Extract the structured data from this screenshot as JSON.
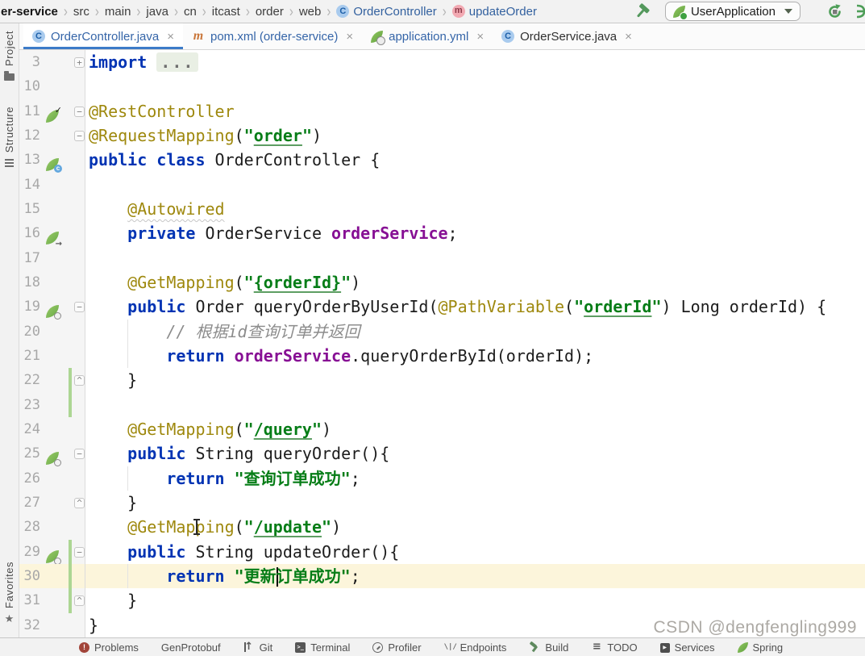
{
  "breadcrumb_bar": {
    "separator": "›",
    "path": [
      {
        "label": "er-service",
        "style": "bold"
      },
      {
        "label": "src"
      },
      {
        "label": "main"
      },
      {
        "label": "java"
      },
      {
        "label": "cn"
      },
      {
        "label": "itcast"
      },
      {
        "label": "order"
      },
      {
        "label": "web"
      },
      {
        "label": "OrderController",
        "icon": "class-icon",
        "style": "link"
      },
      {
        "label": "updateOrder",
        "icon": "method-icon",
        "style": "link"
      }
    ],
    "run_widget": {
      "config_name": "UserApplication"
    }
  },
  "tool_window_bar": {
    "items": [
      {
        "label": "Project",
        "icon": "project-icon"
      },
      {
        "label": "Structure",
        "icon": "structure-icon"
      },
      {
        "label": "Favorites",
        "icon": "favorites-icon"
      }
    ]
  },
  "editor_tabs": [
    {
      "label": "OrderController.java",
      "icon": "java-class-icon",
      "active": true,
      "modified": true
    },
    {
      "label": "pom.xml (order-service)",
      "icon": "maven-icon",
      "active": false,
      "modified": true
    },
    {
      "label": "application.yml",
      "icon": "spring-config-icon",
      "active": false,
      "modified": true
    },
    {
      "label": "OrderService.java",
      "icon": "java-class-icon",
      "active": false,
      "modified": false
    }
  ],
  "ui_glyphs": {
    "close": "×"
  },
  "editor": {
    "fold_glyphs": {
      "plus": "+",
      "minus": "−",
      "end": "^"
    },
    "lines": [
      {
        "num": "3",
        "indent": 0,
        "fold": "plus",
        "tokens": [
          [
            "kw",
            "import"
          ],
          [
            "pln",
            " "
          ],
          [
            "ellipsis",
            "..."
          ]
        ]
      },
      {
        "num": "10",
        "indent": 0,
        "tokens": []
      },
      {
        "num": "11",
        "indent": 0,
        "fold": "minus",
        "icon": "spring-bean-check-icon",
        "tokens": [
          [
            "ann",
            "@RestController"
          ]
        ]
      },
      {
        "num": "12",
        "indent": 0,
        "fold": "minus",
        "tokens": [
          [
            "ann",
            "@RequestMapping"
          ],
          [
            "pln",
            "("
          ],
          [
            "str",
            "\""
          ],
          [
            "strU",
            "order"
          ],
          [
            "str",
            "\""
          ],
          [
            "pln",
            ")"
          ]
        ]
      },
      {
        "num": "13",
        "indent": 0,
        "icon": "spring-class-icon",
        "tokens": [
          [
            "kw",
            "public class"
          ],
          [
            "pln",
            " OrderController {"
          ]
        ]
      },
      {
        "num": "14",
        "indent": 0,
        "tokens": []
      },
      {
        "num": "15",
        "indent": 1,
        "tokens": [
          [
            "annW",
            "@Autowired"
          ]
        ]
      },
      {
        "num": "16",
        "indent": 1,
        "icon": "autowired-icon",
        "tokens": [
          [
            "kw",
            "private"
          ],
          [
            "pln",
            " OrderService "
          ],
          [
            "fld",
            "orderService"
          ],
          [
            "pln",
            ";"
          ]
        ]
      },
      {
        "num": "17",
        "indent": 1,
        "tokens": []
      },
      {
        "num": "18",
        "indent": 1,
        "tokens": [
          [
            "ann",
            "@GetMapping"
          ],
          [
            "pln",
            "("
          ],
          [
            "str",
            "\""
          ],
          [
            "strU",
            "{orderId}"
          ],
          [
            "str",
            "\""
          ],
          [
            "pln",
            ")"
          ]
        ]
      },
      {
        "num": "19",
        "indent": 1,
        "fold": "minus",
        "icon": "mapping-icon",
        "tokens": [
          [
            "kw",
            "public"
          ],
          [
            "pln",
            " Order queryOrderByUserId("
          ],
          [
            "ann",
            "@PathVariable"
          ],
          [
            "pln",
            "("
          ],
          [
            "str",
            "\""
          ],
          [
            "strU",
            "orderId"
          ],
          [
            "str",
            "\""
          ],
          [
            "pln",
            ") Long orderId) {"
          ]
        ]
      },
      {
        "num": "20",
        "indent": 2,
        "guide": true,
        "tokens": [
          [
            "cmt",
            "// 根据id查询订单并返回"
          ]
        ]
      },
      {
        "num": "21",
        "indent": 2,
        "guide": true,
        "tokens": [
          [
            "kw",
            "return"
          ],
          [
            "pln",
            " "
          ],
          [
            "fld",
            "orderService"
          ],
          [
            "pln",
            ".queryOrderById(orderId);"
          ]
        ]
      },
      {
        "num": "22",
        "indent": 1,
        "fold": "end",
        "change": true,
        "tokens": [
          [
            "pln",
            "}"
          ]
        ]
      },
      {
        "num": "23",
        "indent": 0,
        "change": true,
        "tokens": []
      },
      {
        "num": "24",
        "indent": 1,
        "tokens": [
          [
            "ann",
            "@GetMapping"
          ],
          [
            "pln",
            "("
          ],
          [
            "str",
            "\""
          ],
          [
            "strU",
            "/query"
          ],
          [
            "str",
            "\""
          ],
          [
            "pln",
            ")"
          ]
        ]
      },
      {
        "num": "25",
        "indent": 1,
        "fold": "minus",
        "icon": "mapping-icon",
        "tokens": [
          [
            "kw",
            "public"
          ],
          [
            "pln",
            " String queryOrder(){"
          ]
        ]
      },
      {
        "num": "26",
        "indent": 2,
        "guide": true,
        "tokens": [
          [
            "kw",
            "return"
          ],
          [
            "pln",
            " "
          ],
          [
            "str",
            "\"查询订单成功\""
          ],
          [
            "pln",
            ";"
          ]
        ]
      },
      {
        "num": "27",
        "indent": 1,
        "fold": "end",
        "tokens": [
          [
            "pln",
            "}"
          ]
        ]
      },
      {
        "num": "28",
        "indent": 1,
        "cursor": true,
        "tokens": [
          [
            "ann",
            "@GetMapping"
          ],
          [
            "pln",
            "("
          ],
          [
            "str",
            "\""
          ],
          [
            "strU",
            "/update"
          ],
          [
            "str",
            "\""
          ],
          [
            "pln",
            ")"
          ]
        ]
      },
      {
        "num": "29",
        "indent": 1,
        "fold": "minus",
        "icon": "mapping-icon",
        "change": true,
        "tokens": [
          [
            "kw",
            "public"
          ],
          [
            "pln",
            " String updateOrder(){"
          ]
        ]
      },
      {
        "num": "30",
        "indent": 2,
        "guide": true,
        "highlight": true,
        "change": true,
        "tokens": [
          [
            "kw",
            "return"
          ],
          [
            "pln",
            " "
          ],
          [
            "str",
            "\"更新"
          ],
          [
            "caret",
            ""
          ],
          [
            "str",
            "订单成功\""
          ],
          [
            "pln",
            ";"
          ]
        ]
      },
      {
        "num": "31",
        "indent": 1,
        "fold": "end",
        "change": true,
        "tokens": [
          [
            "pln",
            "}"
          ]
        ]
      },
      {
        "num": "32",
        "indent": 0,
        "tokens": [
          [
            "pln",
            "}"
          ]
        ]
      }
    ]
  },
  "status_bar": {
    "items": [
      {
        "label": "Problems",
        "icon": "problems-icon"
      },
      {
        "label": "GenProtobuf"
      },
      {
        "label": "Git",
        "icon": "git-icon"
      },
      {
        "label": "Terminal",
        "icon": "terminal-icon"
      },
      {
        "label": "Profiler",
        "icon": "profiler-icon"
      },
      {
        "label": "Endpoints",
        "icon": "endpoints-icon"
      },
      {
        "label": "Build",
        "icon": "build-icon"
      },
      {
        "label": "TODO",
        "icon": "todo-icon"
      },
      {
        "label": "Services",
        "icon": "services-icon"
      },
      {
        "label": "Spring",
        "icon": "spring-icon"
      }
    ]
  },
  "watermark": "CSDN @dengfengling999",
  "colors": {
    "keyword": "#0033B3",
    "annotation": "#9E880D",
    "string": "#067D17",
    "field": "#871094",
    "comment": "#8C8C8C",
    "accent_blue": "#3C7BC8",
    "spring_green": "#6DB33F",
    "line_highlight": "#FCF5DB",
    "change_marker_green": "#ACD693"
  }
}
